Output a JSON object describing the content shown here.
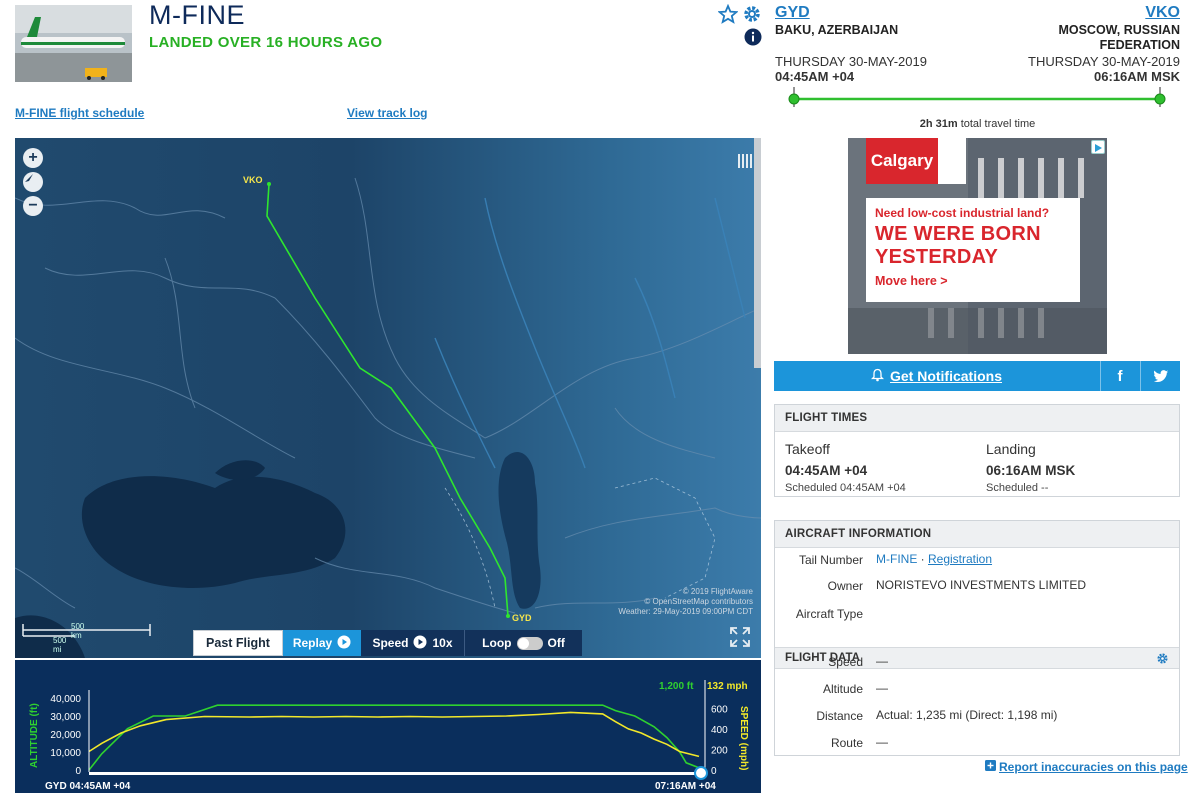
{
  "flight": {
    "ident": "M-FINE",
    "status": "LANDED OVER 16 HOURS AGO",
    "schedule_link": "M-FINE flight schedule",
    "track_log_link": "View track log"
  },
  "origin": {
    "code": "GYD",
    "city": "BAKU, AZERBAIJAN",
    "date": "THURSDAY 30-MAY-2019",
    "time": "04:45AM +04"
  },
  "destination": {
    "code": "VKO",
    "city": "MOSCOW, RUSSIAN FEDERATION",
    "date": "THURSDAY 30-MAY-2019",
    "time": "06:16AM MSK"
  },
  "travel": {
    "duration": "2h 31m",
    "suffix": "total travel time"
  },
  "ad": {
    "brand": "Calgary",
    "question": "Need low-cost industrial land?",
    "line1": "WE WERE BORN",
    "line2": "YESTERDAY",
    "cta": "Move here >"
  },
  "actions": {
    "notifications": "Get Notifications",
    "facebook": "f"
  },
  "flight_times": {
    "heading": "FLIGHT TIMES",
    "takeoff_label": "Takeoff",
    "takeoff_time": "04:45AM +04",
    "takeoff_scheduled": "Scheduled 04:45AM +04",
    "landing_label": "Landing",
    "landing_time": "06:16AM MSK",
    "landing_scheduled": "Scheduled --"
  },
  "aircraft_info": {
    "heading": "AIRCRAFT INFORMATION",
    "tail_label": "Tail Number",
    "tail_value": "M-FINE",
    "tail_sep": " · ",
    "registration_link": "Registration",
    "owner_label": "Owner",
    "owner_value": "NORISTEVO INVESTMENTS LIMITED",
    "type_label": "Aircraft Type",
    "type_value": ""
  },
  "flight_data": {
    "heading": "FLIGHT DATA",
    "speed_label": "Speed",
    "speed_value": "—",
    "altitude_label": "Altitude",
    "altitude_value": "—",
    "distance_label": "Distance",
    "distance_value": "Actual: 1,235 mi (Direct: 1,198 mi)",
    "route_label": "Route",
    "route_value": "—"
  },
  "report_link": "Report inaccuracies on this page",
  "map": {
    "origin_label": "GYD",
    "dest_label": "VKO",
    "scale_km": "500 km",
    "scale_mi": "500 mi",
    "copyright_1": "© 2019 FlightAware",
    "copyright_2": "© OpenStreetMap contributors",
    "copyright_3": "Weather: 29-May-2019 09:00PM CDT"
  },
  "controls": {
    "past_flight": "Past Flight",
    "replay": "Replay",
    "speed_label": "Speed",
    "speed_value": "10x",
    "loop_label": "Loop",
    "loop_value": "Off"
  },
  "chart_data": {
    "type": "line",
    "ylabel": "ALTITUDE (ft)",
    "y2label": "SPEED (mph)",
    "y_ticks": [
      "40,000",
      "30,000",
      "20,000",
      "10,000",
      "0"
    ],
    "y2_ticks": [
      "600",
      "400",
      "200",
      "0"
    ],
    "current_altitude": "1,200 ft",
    "current_speed": "132 mph",
    "start_label": "GYD 04:45AM +04",
    "end_label": "07:16AM +04",
    "ylim": [
      0,
      40000
    ],
    "y2lim": [
      0,
      700
    ],
    "colors": {
      "altitude": "#2fd12f",
      "speed": "#f2e82a"
    },
    "series": [
      {
        "name": "Altitude",
        "x": [
          0,
          2,
          6,
          10,
          15,
          20,
          25,
          30,
          35,
          40,
          45,
          50,
          55,
          60,
          65,
          70,
          75,
          80,
          82,
          85,
          88,
          90,
          92,
          93,
          95
        ],
        "values": [
          0,
          9000,
          23000,
          30000,
          30000,
          36000,
          36000,
          36000,
          36000,
          36000,
          36000,
          36000,
          36000,
          36000,
          36000,
          36000,
          36000,
          36000,
          33000,
          30000,
          24000,
          18000,
          10000,
          4000,
          1200
        ]
      },
      {
        "name": "Speed",
        "x": [
          0,
          2,
          5,
          8,
          12,
          18,
          25,
          30,
          35,
          40,
          45,
          50,
          55,
          60,
          65,
          70,
          75,
          80,
          82,
          84,
          86,
          88,
          90,
          92,
          95
        ],
        "values": [
          180,
          260,
          360,
          430,
          490,
          520,
          515,
          520,
          515,
          520,
          515,
          520,
          515,
          520,
          525,
          540,
          560,
          545,
          470,
          400,
          360,
          300,
          250,
          180,
          132
        ]
      }
    ]
  }
}
